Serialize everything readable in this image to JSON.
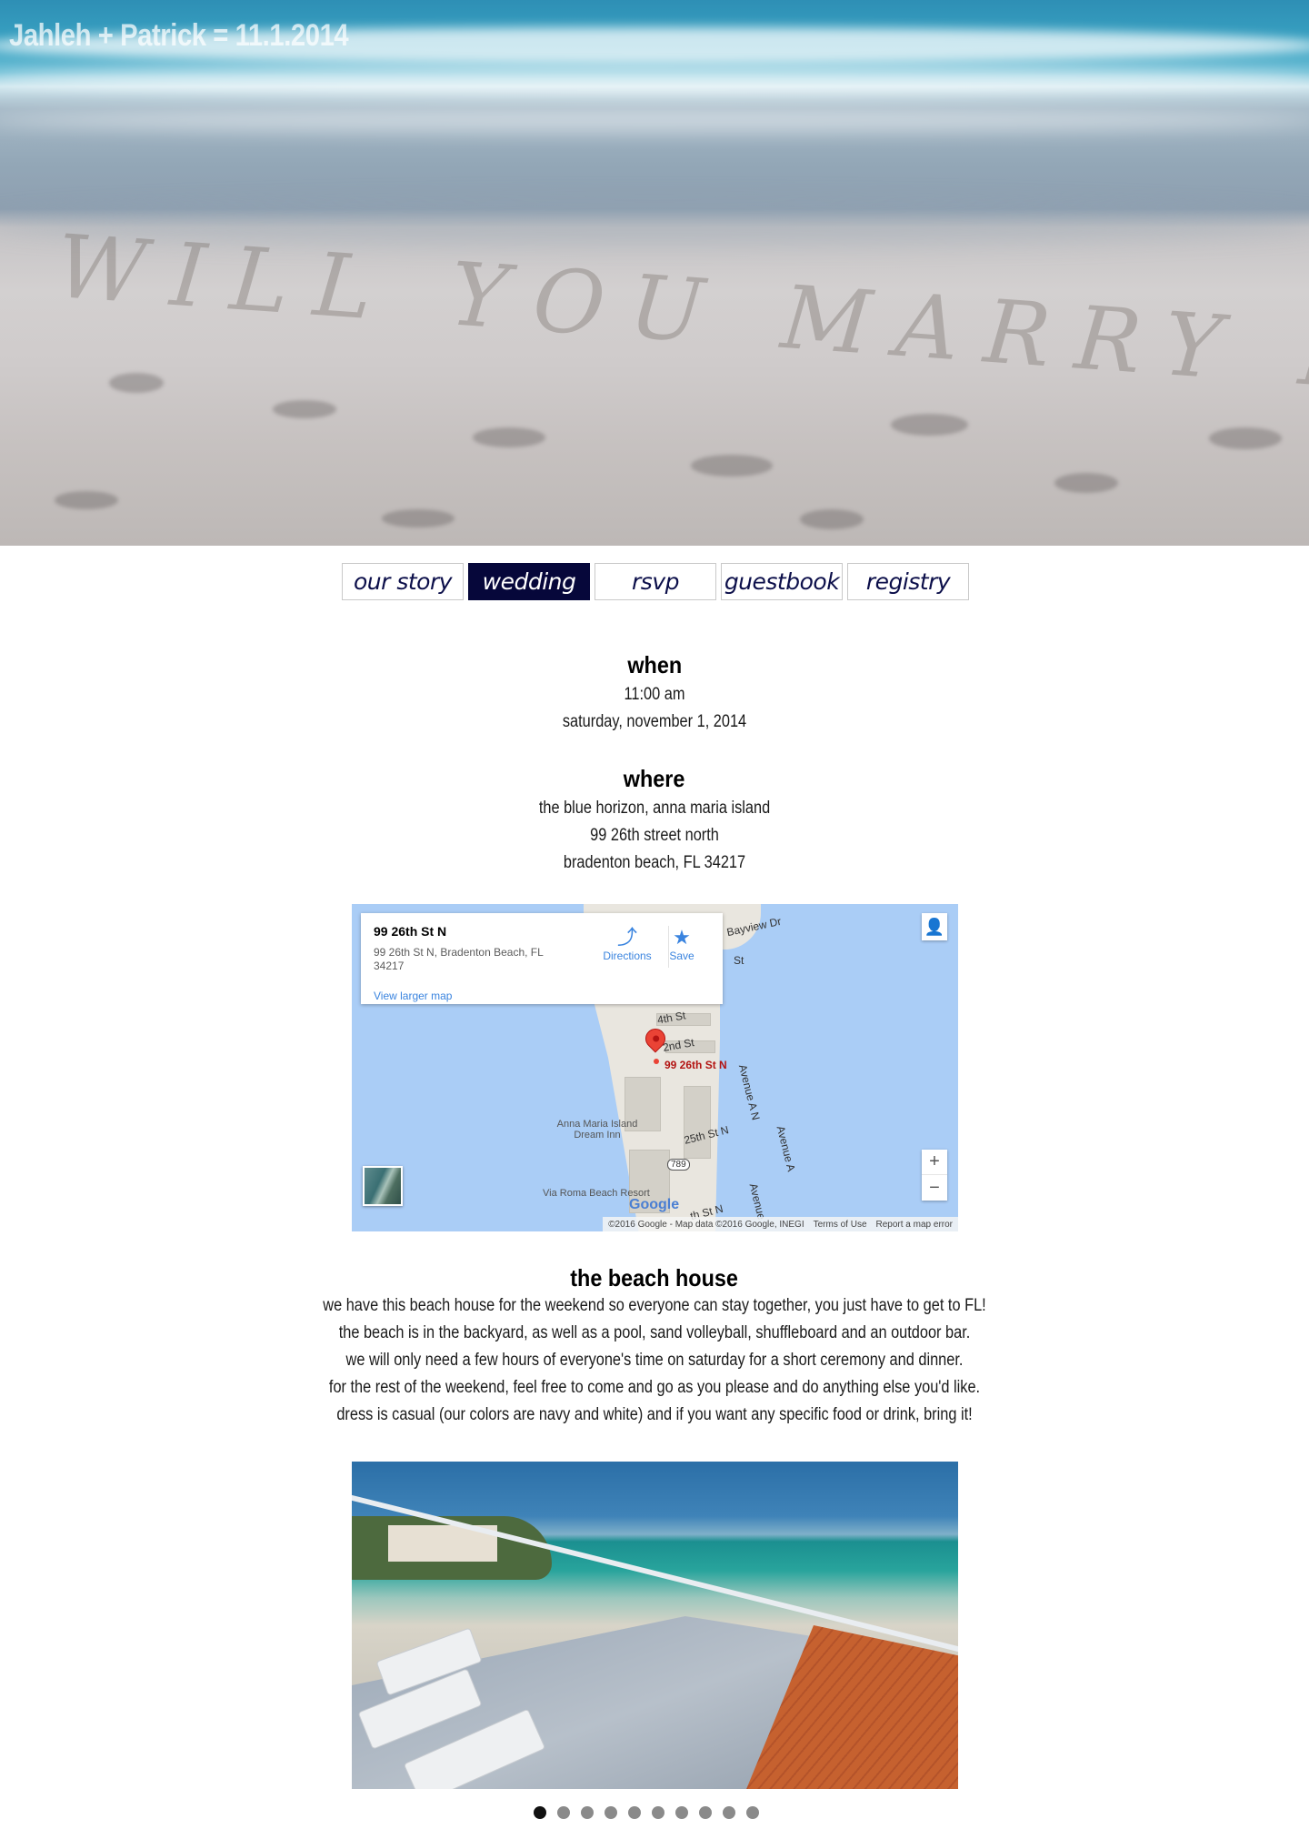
{
  "site": {
    "title": "Jahleh + Patrick = 11.1.2014"
  },
  "nav": {
    "tabs": [
      {
        "label": "our story",
        "active": false
      },
      {
        "label": "wedding",
        "active": true
      },
      {
        "label": "rsvp",
        "active": false
      },
      {
        "label": "guestbook",
        "active": false
      },
      {
        "label": "registry",
        "active": false
      }
    ]
  },
  "when": {
    "heading": "when",
    "time": "11:00 am",
    "date": "saturday, november 1, 2014"
  },
  "where": {
    "heading": "where",
    "venue": "the blue horizon, anna maria island",
    "street": "99 26th street north",
    "city": "bradenton beach, FL 34217"
  },
  "map": {
    "card_title": "99 26th St N",
    "card_address": "99 26th St N, Bradenton Beach, FL 34217",
    "view_larger": "View larger map",
    "directions_label": "Directions",
    "save_label": "Save",
    "pin_label": "99 26th St N",
    "streets": {
      "bayview": "Bayview Dr",
      "st_top": "St",
      "fourth": "4th St",
      "second": "2nd St",
      "twentyfifth": "25th St N",
      "avenue_a_n": "Avenue A N",
      "avenue_a": "Avenue A",
      "avenue_a_bottom": "Avenue",
      "th_st_n": "th St N",
      "resort": "Anna Maria Island Dream Inn",
      "via_roma": "Via Roma Beach Resort",
      "route": "789"
    },
    "google": "Google",
    "copyright": "©2016 Google - Map data ©2016 Google, INEGI",
    "terms": "Terms of Use",
    "report": "Report a map error",
    "zoom_in": "+",
    "zoom_out": "−"
  },
  "beach_house": {
    "heading": "the beach house",
    "lines": [
      "we have this beach house for the weekend so everyone can stay together, you just have to get to FL!",
      "the beach is in the backyard, as well as a pool, sand volleyball, shuffleboard and an outdoor bar.",
      "we will only need a few hours of everyone's time on saturday for a short ceremony and dinner.",
      "for the rest of the weekend, feel free to come and go as you please and do anything else you'd like.",
      "dress is casual (our colors are navy and white) and if you want any specific food or drink, bring it!"
    ]
  },
  "carousel": {
    "count": 10,
    "active_index": 0
  },
  "colors": {
    "nav_active_bg": "#06073a",
    "nav_text": "#0c0f4a",
    "map_water": "#aacdf6",
    "map_link": "#3a84df",
    "pin": "#ea4335"
  }
}
